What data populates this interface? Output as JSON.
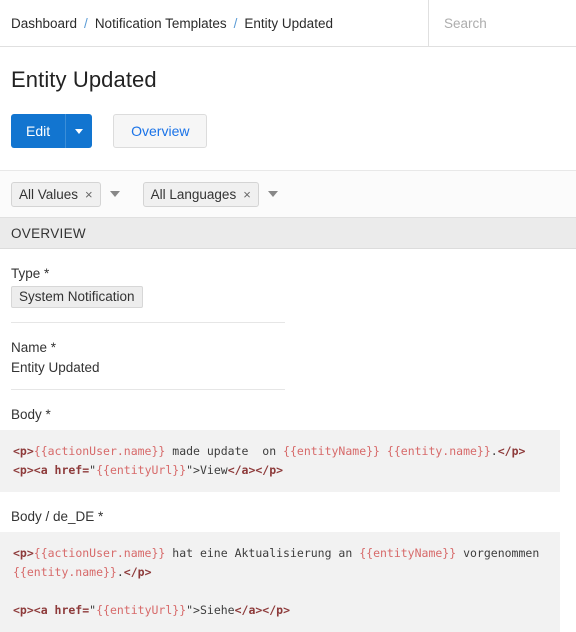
{
  "header": {
    "breadcrumb": [
      {
        "label": "Dashboard"
      },
      {
        "label": "Notification Templates"
      },
      {
        "label": "Entity Updated"
      }
    ],
    "breadcrumb_separator": "/",
    "search": {
      "placeholder": "Search",
      "value": ""
    }
  },
  "page": {
    "title": "Entity Updated"
  },
  "toolbar": {
    "edit_label": "Edit",
    "edit_caret_icon": "chevron-down-icon",
    "overview_label": "Overview",
    "primary_color": "#1275d0",
    "link_color": "#1a73e8"
  },
  "filters": [
    {
      "label": "All Values",
      "remove_icon": "close-icon",
      "remove_glyph": "×",
      "caret_icon": "chevron-down-icon"
    },
    {
      "label": "All Languages",
      "remove_icon": "close-icon",
      "remove_glyph": "×",
      "caret_icon": "chevron-down-icon"
    }
  ],
  "section": {
    "title": "OVERVIEW"
  },
  "fields": {
    "type": {
      "label": "Type *",
      "value": "System Notification"
    },
    "name": {
      "label": "Name *",
      "value": "Entity Updated"
    },
    "body": {
      "label": "Body *",
      "code_tokens": [
        {
          "t": "tag",
          "s": "<p>"
        },
        {
          "t": "var",
          "s": "{{actionUser.name}}"
        },
        {
          "t": "text",
          "s": " made update  on "
        },
        {
          "t": "var",
          "s": "{{entityName}}"
        },
        {
          "t": "text",
          "s": " "
        },
        {
          "t": "var",
          "s": "{{entity.name}}"
        },
        {
          "t": "text",
          "s": "."
        },
        {
          "t": "tag",
          "s": "</p>"
        },
        {
          "t": "text",
          "s": "\n"
        },
        {
          "t": "tag",
          "s": "<p><a href="
        },
        {
          "t": "text",
          "s": "\""
        },
        {
          "t": "var",
          "s": "{{entityUrl}}"
        },
        {
          "t": "text",
          "s": "\">"
        },
        {
          "t": "text",
          "s": "View"
        },
        {
          "t": "tag",
          "s": "</a></p>"
        }
      ]
    },
    "body_de": {
      "label": "Body / de_DE *",
      "code_tokens": [
        {
          "t": "tag",
          "s": "<p>"
        },
        {
          "t": "var",
          "s": "{{actionUser.name}}"
        },
        {
          "t": "text",
          "s": " hat eine Aktualisierung an "
        },
        {
          "t": "var",
          "s": "{{entityName}}"
        },
        {
          "t": "text",
          "s": " vorgenommen "
        },
        {
          "t": "var",
          "s": "{{entity.name}}"
        },
        {
          "t": "text",
          "s": "."
        },
        {
          "t": "tag",
          "s": "</p>"
        },
        {
          "t": "text",
          "s": "\n\n"
        },
        {
          "t": "tag",
          "s": "<p><a href="
        },
        {
          "t": "text",
          "s": "\""
        },
        {
          "t": "var",
          "s": "{{entityUrl}}"
        },
        {
          "t": "text",
          "s": "\">"
        },
        {
          "t": "text",
          "s": "Siehe"
        },
        {
          "t": "tag",
          "s": "</a></p>"
        }
      ]
    }
  }
}
